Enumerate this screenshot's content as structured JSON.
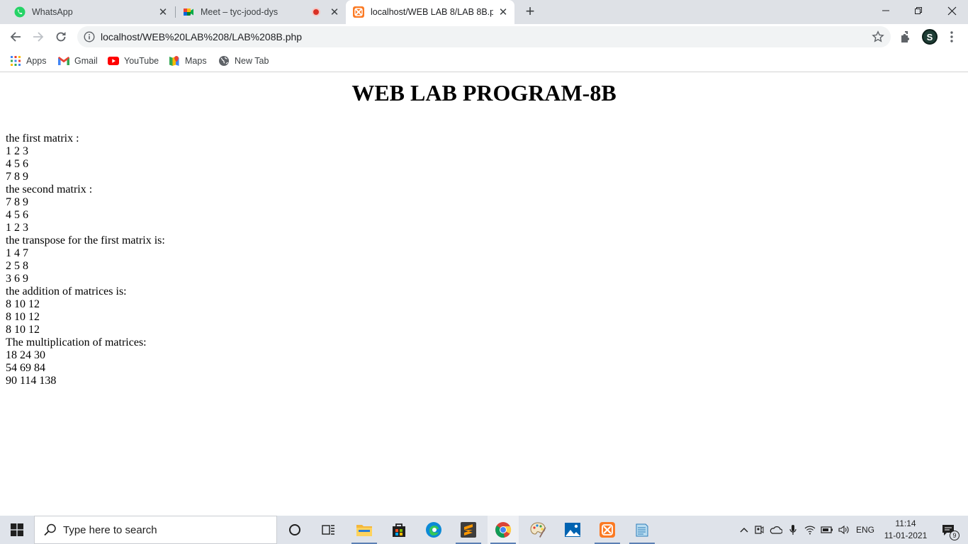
{
  "browser": {
    "tabs": [
      {
        "title": "WhatsApp",
        "icon": "whatsapp-icon"
      },
      {
        "title": "Meet – tyc-jood-dys",
        "icon": "google-meet-icon",
        "recording": true
      },
      {
        "title": "localhost/WEB LAB 8/LAB 8B.php",
        "icon": "xampp-icon",
        "active": true
      }
    ],
    "address_url": "localhost/WEB%20LAB%208/LAB%208B.php",
    "profile_initial": "S",
    "bookmarks": [
      {
        "label": "Apps",
        "icon": "apps-grid-icon"
      },
      {
        "label": "Gmail",
        "icon": "gmail-icon"
      },
      {
        "label": "YouTube",
        "icon": "youtube-icon"
      },
      {
        "label": "Maps",
        "icon": "maps-icon"
      },
      {
        "label": "New Tab",
        "icon": "globe-icon"
      }
    ]
  },
  "page": {
    "heading": "WEB LAB PROGRAM-8B",
    "lines": [
      "the first matrix :",
      "1 2 3",
      "4 5 6",
      "7 8 9",
      "the second matrix :",
      "7 8 9",
      "4 5 6",
      "1 2 3",
      "the transpose for the first matrix is:",
      "1 4 7",
      "2 5 8",
      "3 6 9",
      "the addition of matrices is:",
      "8 10 12",
      "8 10 12",
      "8 10 12",
      "The multiplication of matrices:",
      "18 24 30",
      "54 69 84",
      "90 114 138"
    ]
  },
  "taskbar": {
    "search_placeholder": "Type here to search",
    "language": "ENG",
    "time": "11:14",
    "date": "11-01-2021",
    "notification_count": "9"
  }
}
